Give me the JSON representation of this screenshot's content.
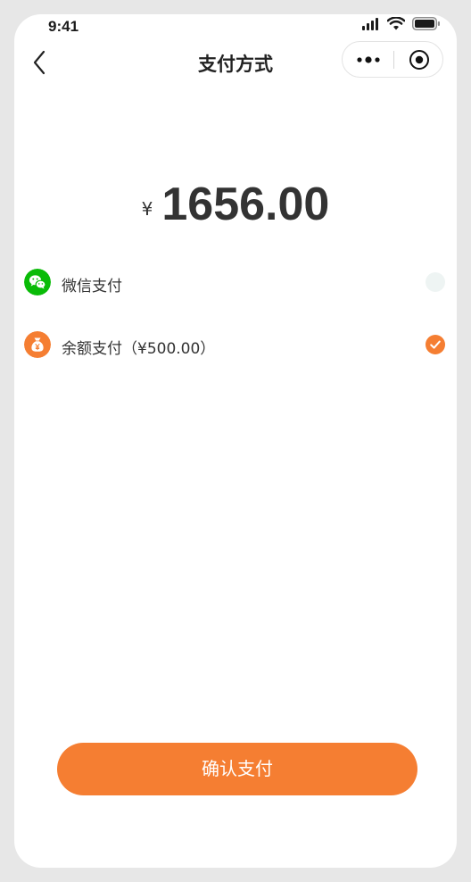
{
  "status_bar": {
    "time": "9:41"
  },
  "nav": {
    "title": "支付方式"
  },
  "amount": {
    "currency": "¥",
    "value": "1656.00"
  },
  "payment_methods": [
    {
      "label": "微信支付",
      "icon": "wechat-icon",
      "selected": false,
      "color": "#09bb07"
    },
    {
      "label": "余额支付（¥500.00）",
      "icon": "money-bag-icon",
      "selected": true,
      "color": "#f57e32"
    }
  ],
  "confirm": {
    "label": "确认支付"
  },
  "colors": {
    "accent": "#f57e32",
    "wechat": "#09bb07",
    "frame": "#e7e7e7"
  }
}
